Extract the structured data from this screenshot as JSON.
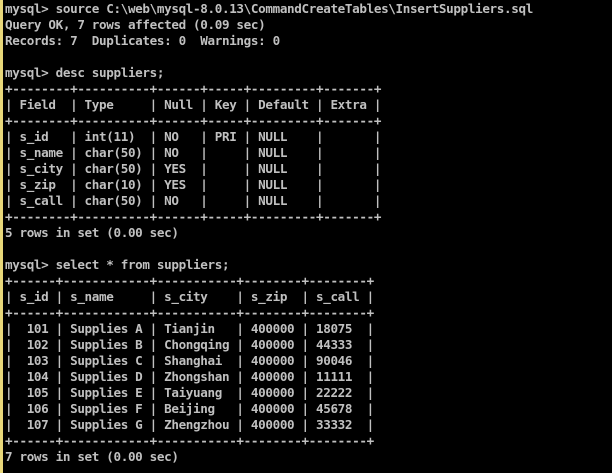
{
  "window": {
    "colors": {
      "background": "#000000",
      "text": "#c0c0c0",
      "accent": "#e8d77a"
    }
  },
  "console": {
    "lines": [
      "mysql> source C:\\web\\mysql-8.0.13\\CommandCreateTables\\InsertSuppliers.sql",
      "Query OK, 7 rows affected (0.09 sec)",
      "Records: 7  Duplicates: 0  Warnings: 0",
      "",
      "mysql> desc suppliers;",
      "+--------+----------+------+-----+---------+-------+",
      "| Field  | Type     | Null | Key | Default | Extra |",
      "+--------+----------+------+-----+---------+-------+",
      "| s_id   | int(11)  | NO   | PRI | NULL    |       |",
      "| s_name | char(50) | NO   |     | NULL    |       |",
      "| s_city | char(50) | YES  |     | NULL    |       |",
      "| s_zip  | char(10) | YES  |     | NULL    |       |",
      "| s_call | char(50) | NO   |     | NULL    |       |",
      "+--------+----------+------+-----+---------+-------+",
      "5 rows in set (0.00 sec)",
      "",
      "mysql> select * from suppliers;",
      "+------+------------+-----------+--------+--------+",
      "| s_id | s_name     | s_city    | s_zip  | s_call |",
      "+------+------------+-----------+--------+--------+",
      "|  101 | Supplies A | Tianjin   | 400000 | 18075  |",
      "|  102 | Supplies B | Chongqing | 400000 | 44333  |",
      "|  103 | Supplies C | Shanghai  | 400000 | 90046  |",
      "|  104 | Supplies D | Zhongshan | 400000 | 11111  |",
      "|  105 | Supplies E | Taiyuang  | 400000 | 22222  |",
      "|  106 | Supplies F | Beijing   | 400000 | 45678  |",
      "|  107 | Supplies G | Zhengzhou | 400000 | 33332  |",
      "+------+------------+-----------+--------+--------+",
      "7 rows in set (0.00 sec)"
    ]
  }
}
